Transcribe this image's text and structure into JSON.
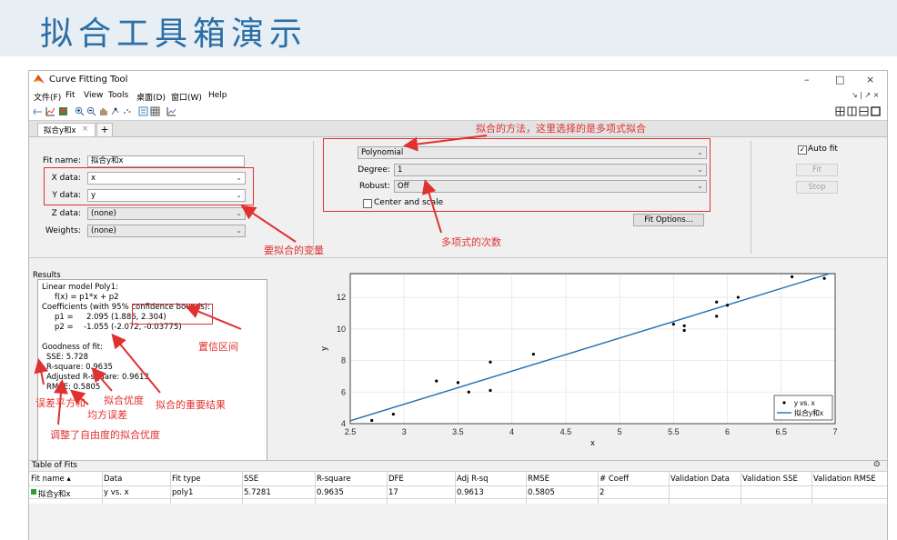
{
  "banner": {
    "title": "拟合工具箱演示"
  },
  "window": {
    "title": "Curve Fitting Tool",
    "controls": {
      "minimize": "–",
      "maximize": "□",
      "close": "×"
    }
  },
  "menu": {
    "items": [
      "文件(F)",
      "Fit",
      "View",
      "Tools",
      "桌面(D)",
      "窗口(W)",
      "Help"
    ],
    "right": "↘ | ↗ ×"
  },
  "tabs": [
    {
      "label": "拟合y和x",
      "close": "×"
    }
  ],
  "tab_add": "+",
  "fit_panel": {
    "fit_name_label": "Fit name:",
    "fit_name_value": "拟合y和x",
    "x_label": "X data:",
    "x_value": "x",
    "y_label": "Y data:",
    "y_value": "y",
    "z_label": "Z data:",
    "z_value": "(none)",
    "w_label": "Weights:",
    "w_value": "(none)"
  },
  "method_panel": {
    "method_value": "Polynomial",
    "degree_label": "Degree:",
    "degree_value": "1",
    "robust_label": "Robust:",
    "robust_value": "Off",
    "center_scale_label": "Center and scale",
    "fit_options_button": "Fit Options..."
  },
  "actions": {
    "auto_fit_label": "Auto fit",
    "auto_fit_checked": true,
    "fit_button": "Fit",
    "stop_button": "Stop"
  },
  "results": {
    "header": "Results",
    "lines": [
      "Linear model Poly1:",
      "f(x) = p1*x + p2",
      "Coefficients (with 95% confidence bounds):",
      "p1 =",
      "p2 =",
      "Goodness of fit:",
      "SSE: 5.728",
      "R-square: 0.9635",
      "Adjusted R-square: 0.9613",
      "RMSE: 0.5805"
    ],
    "p1_value": "2.095",
    "p1_bounds": "(1.886, 2.304)",
    "p2_value": "-1.055",
    "p2_bounds": "(-2.072, -0.03775)"
  },
  "annotations": {
    "method": "拟合的方法，这里选择的是多项式拟合",
    "variables": "要拟合的变量",
    "degree": "多项式的次数",
    "confidence": "置信区间",
    "sse": "误差平方和",
    "rsquare": "拟合优度",
    "rmse": "均方误差",
    "important": "拟合的重要结果",
    "adjusted": "调整了自由度的拟合优度"
  },
  "chart_data": {
    "type": "scatter",
    "xlabel": "x",
    "ylabel": "y",
    "xlim": [
      2.5,
      7
    ],
    "ylim": [
      4,
      13.5
    ],
    "xticks": [
      "2.5",
      "3",
      "3.5",
      "4",
      "4.5",
      "5",
      "5.5",
      "6",
      "6.5",
      "7"
    ],
    "yticks": [
      "4",
      "6",
      "8",
      "10",
      "12"
    ],
    "grid": true,
    "legend_position": "bottom-right",
    "series": [
      {
        "name": "y vs. x",
        "kind": "scatter",
        "color": "#000000",
        "x": [
          2.7,
          2.9,
          3.3,
          3.5,
          3.6,
          3.8,
          3.8,
          4.2,
          5.5,
          5.6,
          5.6,
          5.9,
          5.9,
          6.0,
          6.1,
          6.6,
          6.9
        ],
        "y": [
          4.2,
          4.6,
          6.7,
          6.6,
          6.0,
          6.1,
          7.9,
          8.4,
          10.3,
          10.2,
          9.9,
          11.7,
          10.8,
          11.5,
          12.0,
          13.3,
          13.2
        ]
      },
      {
        "name": "拟合y和x",
        "kind": "line",
        "color": "#1f6fb5",
        "p1": 2.095,
        "p2": -1.055
      }
    ]
  },
  "table_of_fits": {
    "header": "Table of Fits",
    "collapse_icon": "⊙",
    "columns": [
      "Fit name ▴",
      "Data",
      "Fit type",
      "SSE",
      "R-square",
      "DFE",
      "Adj R-sq",
      "RMSE",
      "# Coeff",
      "Validation Data",
      "Validation SSE",
      "Validation RMSE"
    ],
    "rows": [
      [
        "拟合y和x",
        "y vs. x",
        "poly1",
        "5.7281",
        "0.9635",
        "17",
        "0.9613",
        "0.5805",
        "2",
        "",
        "",
        ""
      ]
    ]
  }
}
